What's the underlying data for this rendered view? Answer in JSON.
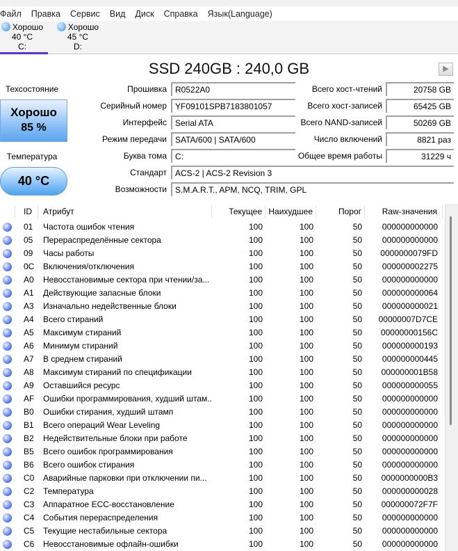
{
  "menu": [
    "Файл",
    "Правка",
    "Сервис",
    "Вид",
    "Диск",
    "Справка",
    "Язык(Language)"
  ],
  "disks": [
    {
      "status": "Хорошо",
      "temp": "40 °C",
      "letter": "C:"
    },
    {
      "status": "Хорошо",
      "temp": "45 °C",
      "letter": "D:"
    }
  ],
  "model": "SSD 240GB : 240,0 GB",
  "health": {
    "label": "Техсостояние",
    "status": "Хорошо",
    "percent": "85 %"
  },
  "temperature": {
    "label": "Температура",
    "value": "40 °C"
  },
  "info_left": [
    {
      "label": "Прошивка",
      "value": "R0522A0"
    },
    {
      "label": "Серийный номер",
      "value": "YF09101SPB7183801057"
    },
    {
      "label": "Интерфейс",
      "value": "Serial ATA"
    },
    {
      "label": "Режим передачи",
      "value": "SATA/600 | SATA/600"
    },
    {
      "label": "Буква тома",
      "value": "C:"
    }
  ],
  "info_right": [
    {
      "label": "Всего хост-чтений",
      "value": "20758 GB"
    },
    {
      "label": "Всего хост-записей",
      "value": "65425 GB"
    },
    {
      "label": "Всего NAND-записей",
      "value": "50269 GB"
    },
    {
      "label": "Число включений",
      "value": "8821 раз"
    },
    {
      "label": "Общее время работы",
      "value": "31229 ч"
    }
  ],
  "standard": {
    "label": "Стандарт",
    "value": "ACS-2 | ACS-2 Revision 3"
  },
  "features": {
    "label": "Возможности",
    "value": "S.M.A.R.T., APM, NCQ, TRIM, GPL"
  },
  "columns": [
    "ID",
    "Атрибут",
    "Текущее",
    "Наихудшее",
    "Порог",
    "Raw-значения"
  ],
  "rows": [
    [
      "01",
      "Частота ошибок чтения",
      "100",
      "100",
      "50",
      "000000000000"
    ],
    [
      "05",
      "Перераспределённые сектора",
      "100",
      "100",
      "50",
      "000000000000"
    ],
    [
      "09",
      "Часы работы",
      "100",
      "100",
      "50",
      "0000000079FD"
    ],
    [
      "0C",
      "Включения/отключения",
      "100",
      "100",
      "50",
      "000000002275"
    ],
    [
      "A0",
      "Невосстановимые сектора при чтении/за...",
      "100",
      "100",
      "50",
      "000000000000"
    ],
    [
      "A1",
      "Действующие запасные блоки",
      "100",
      "100",
      "50",
      "000000000064"
    ],
    [
      "A3",
      "Изначально недейственные блоки",
      "100",
      "100",
      "50",
      "000000000021"
    ],
    [
      "A4",
      "Всего стираний",
      "100",
      "100",
      "50",
      "00000007D7CE"
    ],
    [
      "A5",
      "Максимум стираний",
      "100",
      "100",
      "50",
      "00000000156C"
    ],
    [
      "A6",
      "Минимум стираний",
      "100",
      "100",
      "50",
      "000000000193"
    ],
    [
      "A7",
      "В среднем стираний",
      "100",
      "100",
      "50",
      "000000000445"
    ],
    [
      "A8",
      "Максимум стираний по спецификации",
      "100",
      "100",
      "50",
      "000000001B58"
    ],
    [
      "A9",
      "Оставшийся ресурс",
      "100",
      "100",
      "50",
      "000000000055"
    ],
    [
      "AF",
      "Ошибки программирования, худший штам...",
      "100",
      "100",
      "50",
      "000000000000"
    ],
    [
      "B0",
      "Ошибки стирания, худший штамп",
      "100",
      "100",
      "50",
      "000000000000"
    ],
    [
      "B1",
      "Всего операций Wear Leveling",
      "100",
      "100",
      "50",
      "000000000000"
    ],
    [
      "B2",
      "Недействительные блоки при работе",
      "100",
      "100",
      "50",
      "000000000000"
    ],
    [
      "B5",
      "Всего ошибок программирования",
      "100",
      "100",
      "50",
      "000000000000"
    ],
    [
      "B6",
      "Всего ошибок стирания",
      "100",
      "100",
      "50",
      "000000000000"
    ],
    [
      "C0",
      "Аварийные парковки при отключении пи...",
      "100",
      "100",
      "50",
      "0000000000B3"
    ],
    [
      "C2",
      "Температура",
      "100",
      "100",
      "50",
      "000000000028"
    ],
    [
      "C3",
      "Аппаратное ECC-восстановление",
      "100",
      "100",
      "50",
      "000000072F7F"
    ],
    [
      "C4",
      "События перераспределения",
      "100",
      "100",
      "50",
      "000000000000"
    ],
    [
      "C5",
      "Текущие нестабильные сектора",
      "100",
      "100",
      "50",
      "000000000000"
    ],
    [
      "C6",
      "Невосстановимые офлайн-ошибки",
      "100",
      "100",
      "50",
      "000000000000"
    ]
  ]
}
